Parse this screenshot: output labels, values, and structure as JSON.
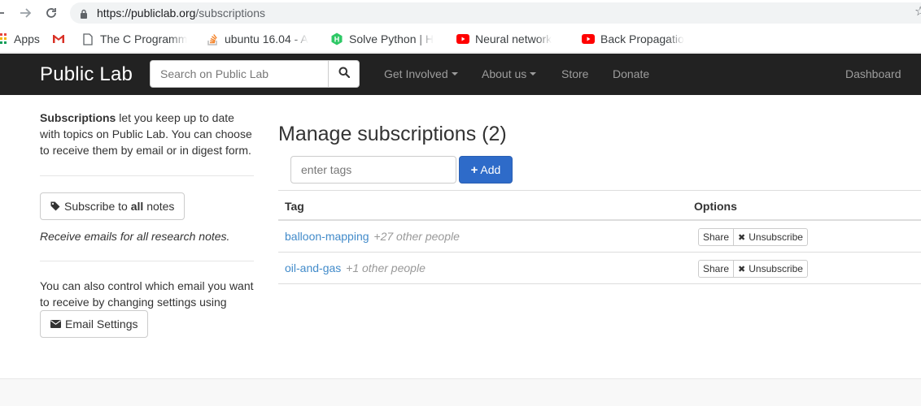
{
  "browser": {
    "url_host": "https://publiclab.org",
    "url_path": "/subscriptions",
    "bookmarks": [
      {
        "label": "Apps",
        "icon": "apps-grid-icon"
      },
      {
        "label": "",
        "icon": "gmail-icon"
      },
      {
        "label": "The C Programm",
        "icon": "page-icon"
      },
      {
        "label": "ubuntu 16.04 - A",
        "icon": "stackoverflow-icon"
      },
      {
        "label": "Solve Python | H",
        "icon": "hackerrank-icon"
      },
      {
        "label": "Neural network",
        "icon": "youtube-icon"
      },
      {
        "label": "Back Propagatio",
        "icon": "youtube-icon"
      }
    ]
  },
  "navbar": {
    "brand": "Public Lab",
    "search_placeholder": "Search on Public Lab",
    "links": {
      "get_involved": "Get Involved",
      "about_us": "About us",
      "store": "Store",
      "donate": "Donate",
      "dashboard": "Dashboard"
    }
  },
  "sidebar": {
    "intro_bold": "Subscriptions",
    "intro_line1": " let you keep up to date",
    "intro_line2": "with topics on Public Lab. You can choose",
    "intro_line3": "to receive them by email or in digest form.",
    "subscribe_pre": "Subscribe to ",
    "subscribe_bold": "all",
    "subscribe_post": " notes",
    "receive_note": "Receive emails for all research notes.",
    "control_line1": "You can also control which email you want",
    "control_line2": "to receive by changing settings using",
    "email_settings": "Email Settings"
  },
  "main": {
    "title": "Manage subscriptions (2)",
    "tag_placeholder": "enter tags",
    "add_label": "Add",
    "table": {
      "headers": {
        "tag": "Tag",
        "options": "Options"
      },
      "rows": [
        {
          "tag": "balloon-mapping",
          "others": "+27 other people",
          "share": "Share",
          "unsubscribe": "Unsubscribe"
        },
        {
          "tag": "oil-and-gas",
          "others": "+1 other people",
          "share": "Share",
          "unsubscribe": "Unsubscribe"
        }
      ]
    }
  },
  "colors": {
    "navbar_bg": "#222222",
    "primary": "#2e6bc9",
    "link": "#428bca"
  }
}
